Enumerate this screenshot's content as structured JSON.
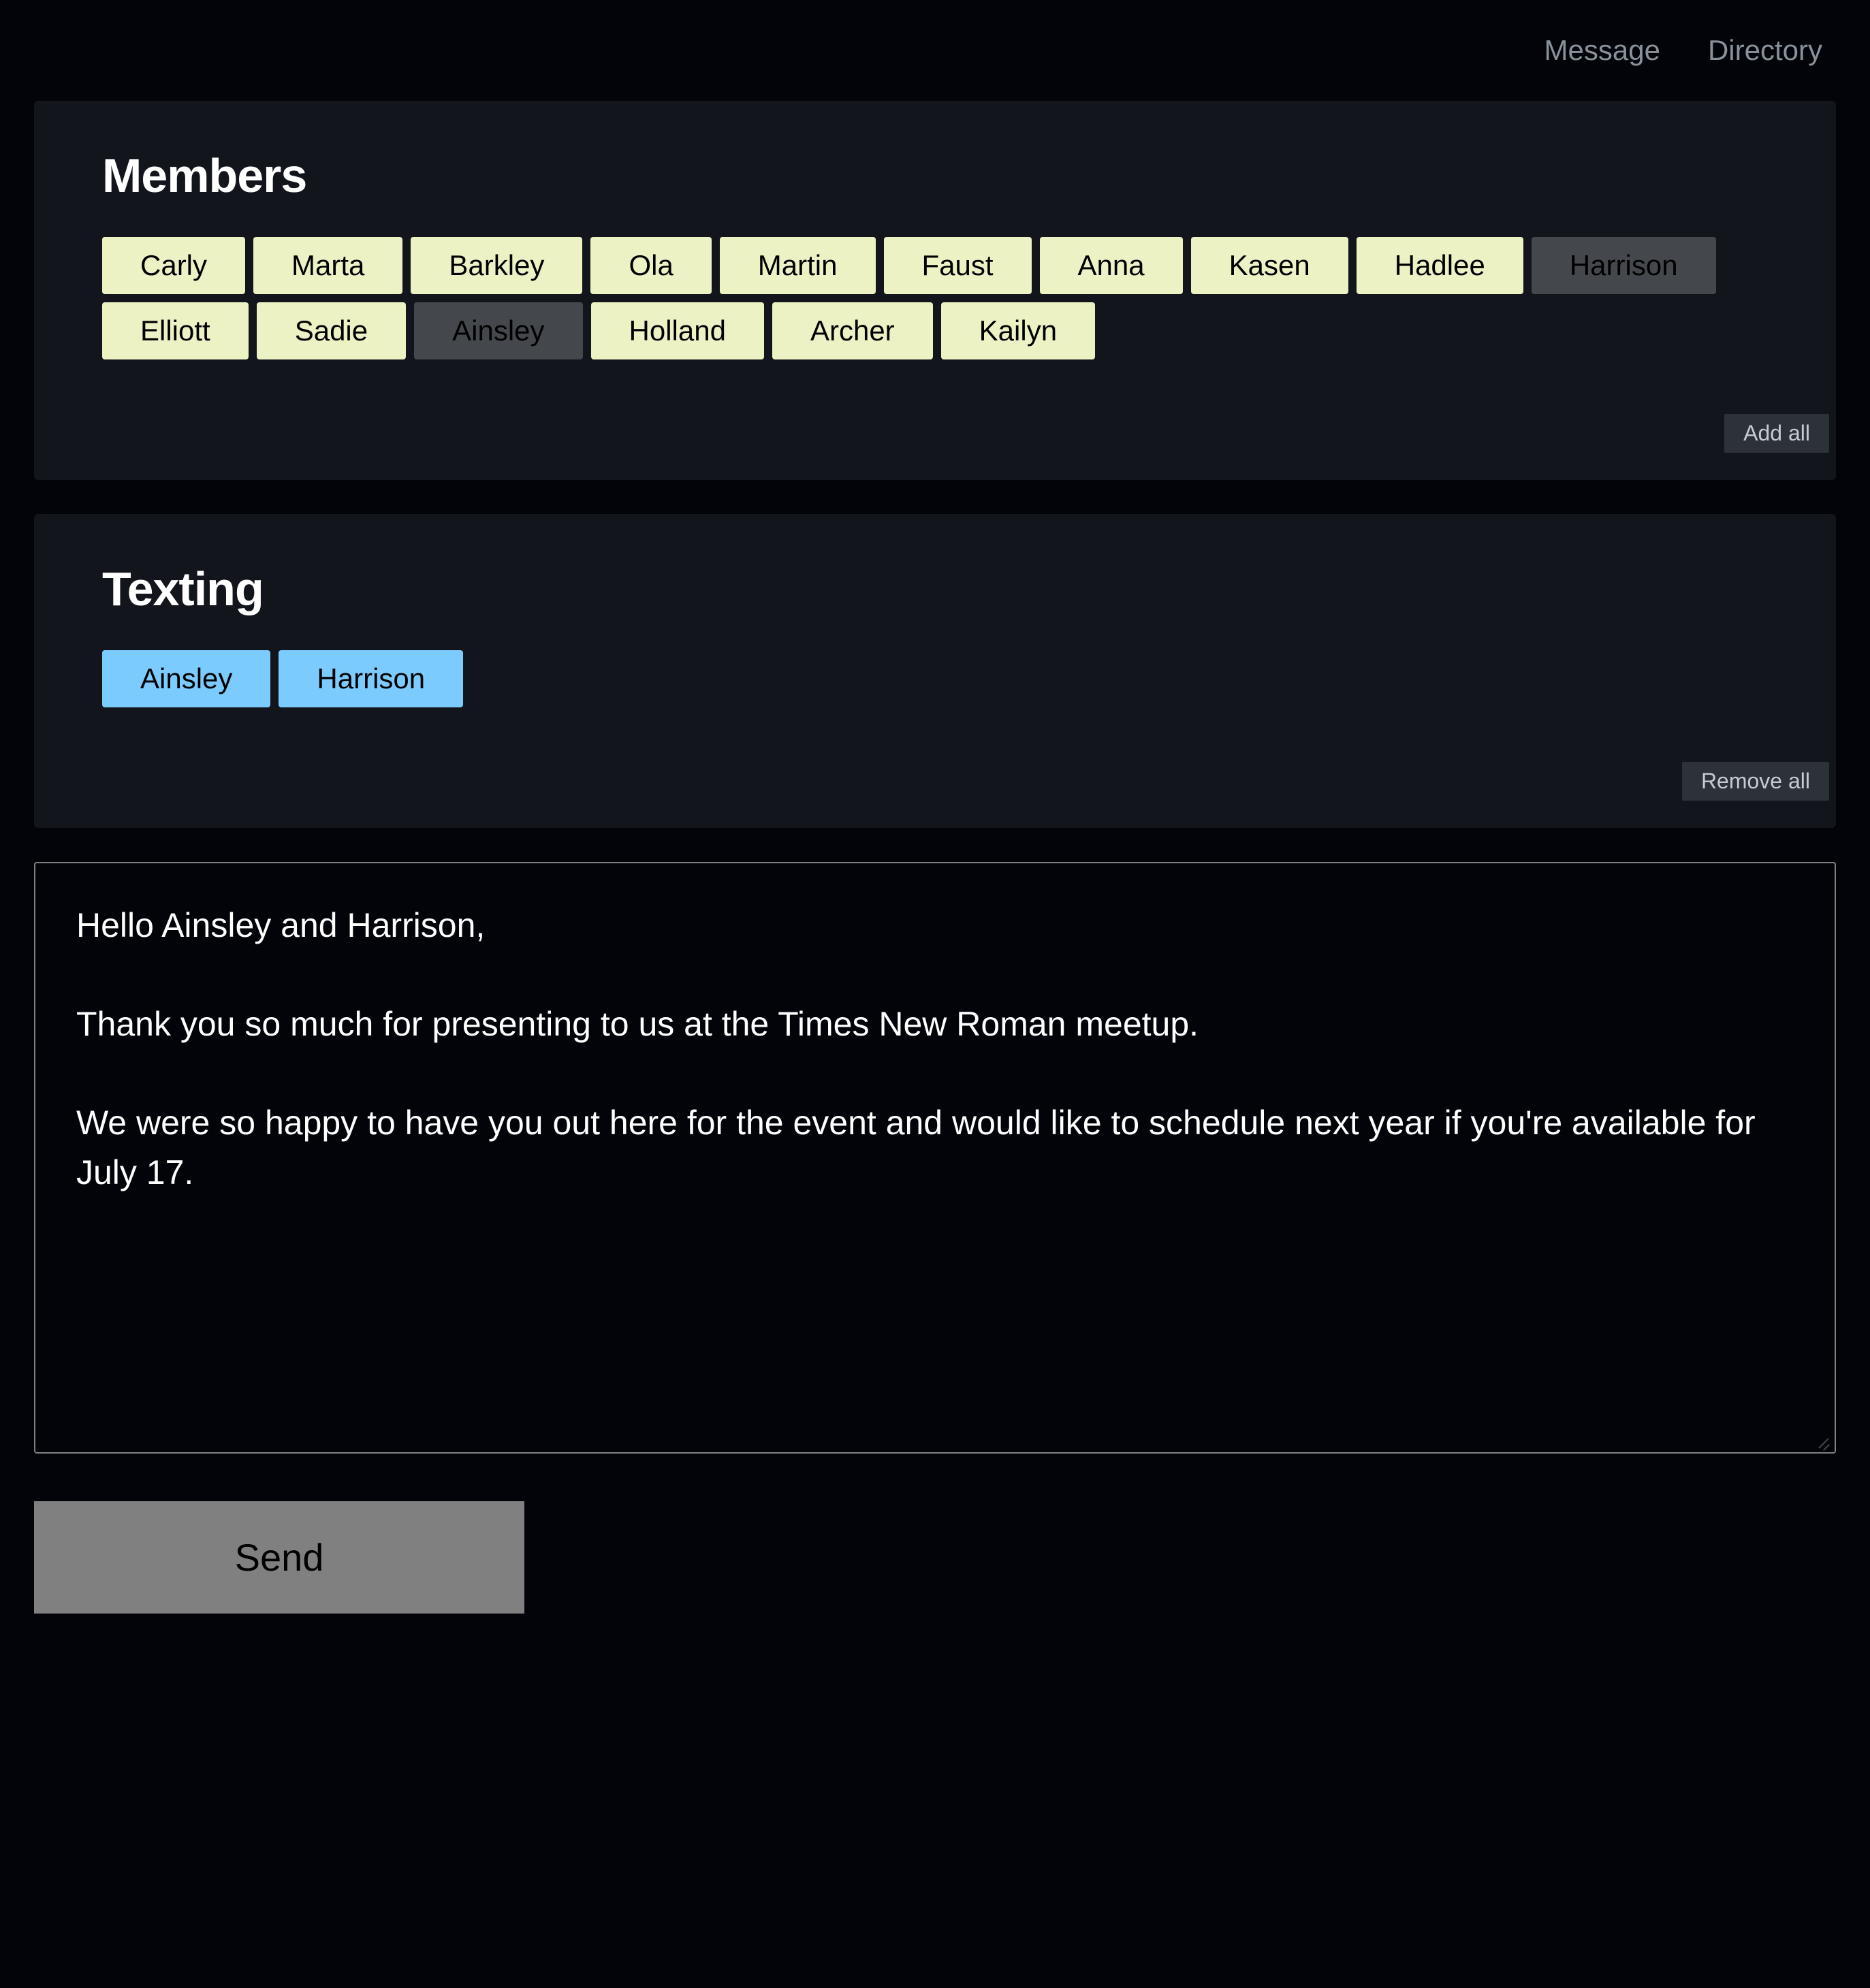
{
  "nav": {
    "message": "Message",
    "directory": "Directory"
  },
  "members": {
    "title": "Members",
    "items": [
      {
        "name": "Carly",
        "selected": false
      },
      {
        "name": "Marta",
        "selected": false
      },
      {
        "name": "Barkley",
        "selected": false
      },
      {
        "name": "Ola",
        "selected": false
      },
      {
        "name": "Martin",
        "selected": false
      },
      {
        "name": "Faust",
        "selected": false
      },
      {
        "name": "Anna",
        "selected": false
      },
      {
        "name": "Kasen",
        "selected": false
      },
      {
        "name": "Hadlee",
        "selected": false
      },
      {
        "name": "Harrison",
        "selected": true
      },
      {
        "name": "Elliott",
        "selected": false
      },
      {
        "name": "Sadie",
        "selected": false
      },
      {
        "name": "Ainsley",
        "selected": true
      },
      {
        "name": "Holland",
        "selected": false
      },
      {
        "name": "Archer",
        "selected": false
      },
      {
        "name": "Kailyn",
        "selected": false
      }
    ],
    "add_all_label": "Add all"
  },
  "texting": {
    "title": "Texting",
    "items": [
      {
        "name": "Ainsley"
      },
      {
        "name": "Harrison"
      }
    ],
    "remove_all_label": "Remove all"
  },
  "compose": {
    "text": "Hello Ainsley and Harrison,\n\nThank you so much for presenting to us at the Times New Roman meetup.\n\nWe were so happy to have you out here for the event and would like to schedule next year if you're available for July 17.",
    "send_label": "Send"
  }
}
